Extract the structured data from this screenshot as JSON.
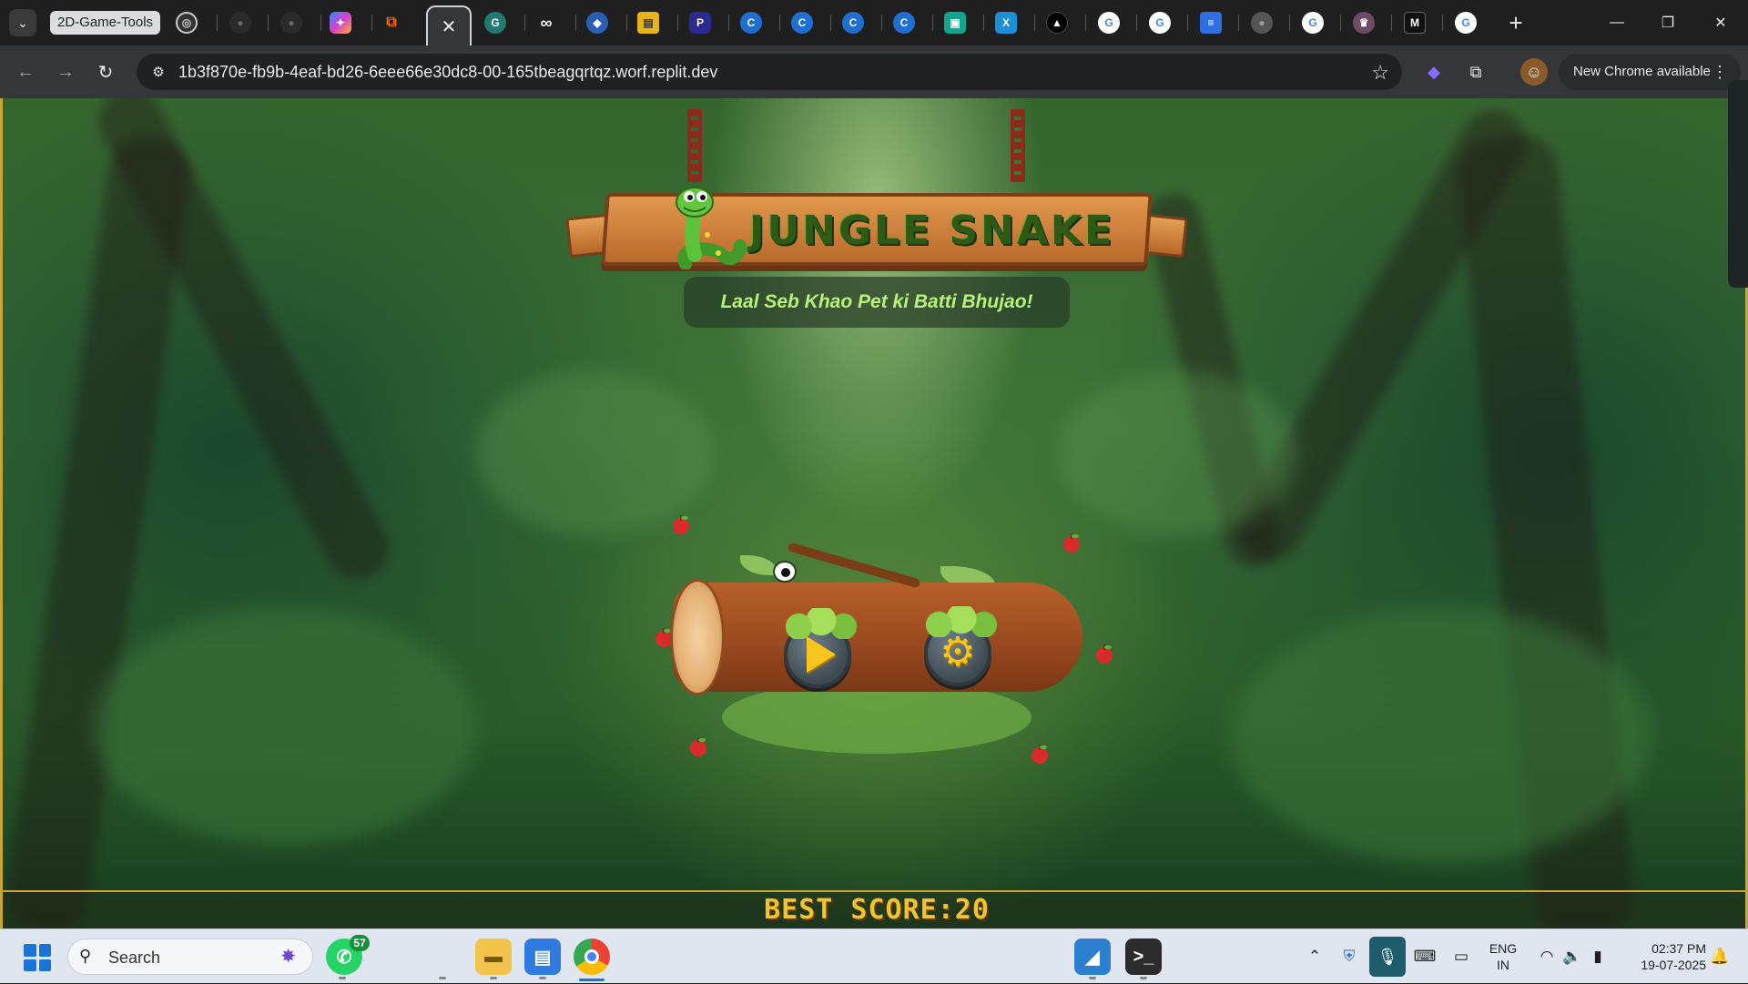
{
  "browser": {
    "tab_group_label": "2D-Game-Tools",
    "active_tab_close": "✕",
    "new_tab": "+",
    "url": "1b3f870e-fb9b-4eaf-bd26-6eee66e30dc8-00-165tbeagqrtqz.worf.replit.dev",
    "update_label": "New Chrome available",
    "tab_favicons": [
      "openai",
      "github",
      "github",
      "copilot",
      "replit",
      "genspark",
      "infinity",
      "code",
      "notebook",
      "perplexity",
      "c-app",
      "c-app",
      "c-app",
      "c-app",
      "grid-app",
      "x-app",
      "triangle-app",
      "google",
      "google",
      "docs",
      "circle-app",
      "google",
      "ai-art",
      "m-app",
      "google"
    ],
    "window_controls": [
      "—",
      "❐",
      "✕"
    ]
  },
  "game": {
    "title": "JUNGLE SNAKE",
    "tagline": "Laal Seb Khao Pet ki Batti Bhujao!",
    "best_score_label": "BEST SCORE:20",
    "play_button": "play",
    "settings_button": "settings"
  },
  "taskbar": {
    "search_placeholder": "Search",
    "whatsapp_badge": "57",
    "lang_line1": "ENG",
    "lang_line2": "IN",
    "time": "02:37 PM",
    "date": "19-07-2025"
  },
  "colors": {
    "accent_gold": "#f2c230",
    "tagline_green": "#b7f27a",
    "title_green": "#2e5a16"
  }
}
